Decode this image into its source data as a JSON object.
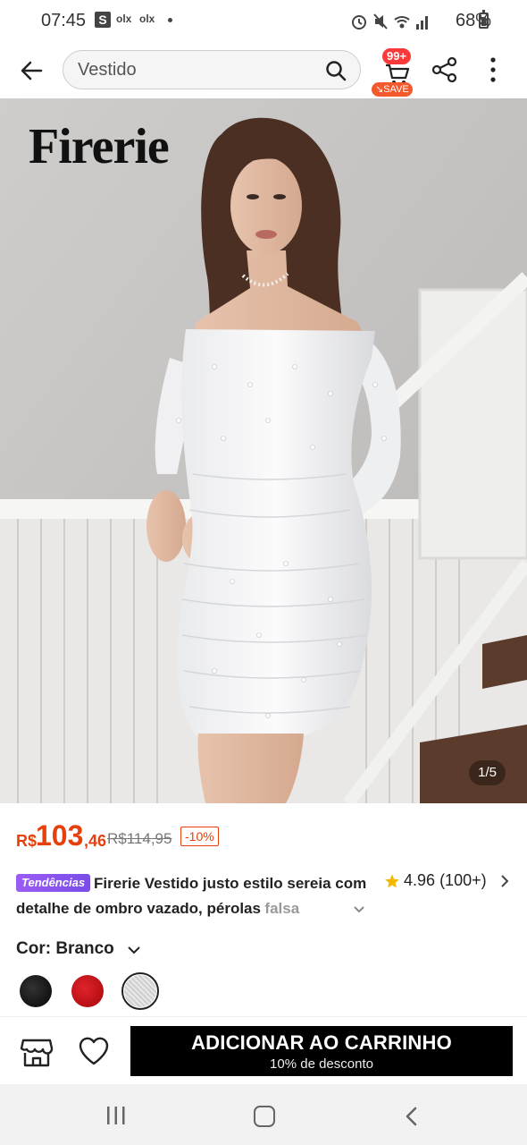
{
  "status_bar": {
    "time": "07:45",
    "app_badge": "S",
    "notif_olx_1": "olx",
    "notif_olx_2": "olx",
    "battery": "68%"
  },
  "header": {
    "search_value": "Vestido",
    "cart_badge": "99+",
    "save_label": "SAVE"
  },
  "image": {
    "brand_logo": "Firerie",
    "counter": "1/5"
  },
  "price": {
    "currency": "R$",
    "integer": "103",
    "cents": ",46",
    "old_price": "R$114,95",
    "discount": "-10%"
  },
  "product": {
    "trend_badge": "Tendências",
    "title_main": "Firerie Vestido justo estilo sereia com detalhe de ombro vazado, pérolas",
    "title_fade": "falsa",
    "rating": "4.96",
    "rating_count": "(100+)"
  },
  "color": {
    "label": "Cor: Branco",
    "options": [
      "black",
      "red",
      "white"
    ],
    "selected": "white"
  },
  "actions": {
    "add_to_cart": "ADICIONAR AO CARRINHO",
    "add_to_cart_sub": "10% de desconto"
  },
  "colors": {
    "price": "#e6400c",
    "badge_red": "#fa3a3a",
    "save_orange": "#f4582d",
    "trend_purple": "#8a55f0",
    "cta_black": "#000000"
  }
}
